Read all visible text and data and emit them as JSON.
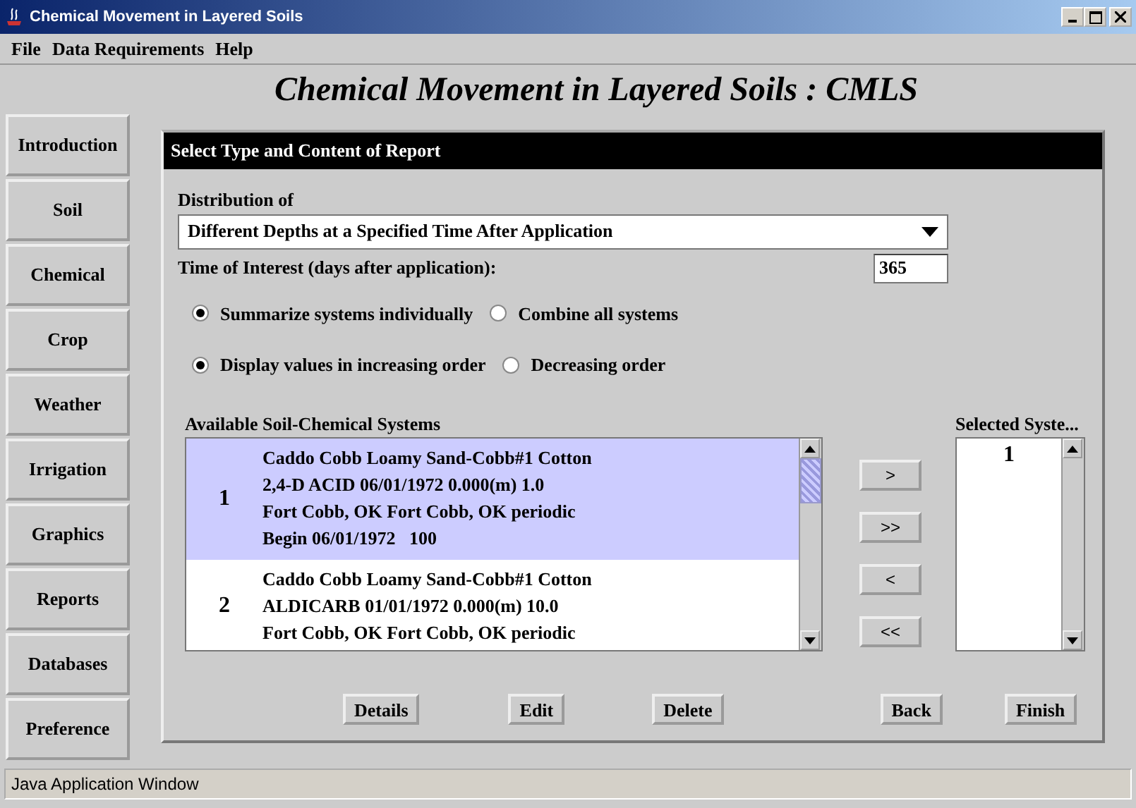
{
  "window": {
    "title": "Chemical Movement in Layered Soils"
  },
  "menu": [
    "File",
    "Data Requirements",
    "Help"
  ],
  "heading": "Chemical Movement in Layered Soils : CMLS",
  "sidebar": {
    "items": [
      "Introduction",
      "Soil",
      "Chemical",
      "Crop",
      "Weather",
      "Irrigation",
      "Graphics",
      "Reports",
      "Databases",
      "Preference"
    ]
  },
  "panel": {
    "title": "Select Type and Content of Report",
    "distribution": {
      "label": "Distribution of",
      "value": "Different Depths at a Specified Time After Application"
    },
    "time_of_interest": {
      "label": "Time of Interest (days after application):",
      "value": "365"
    },
    "radio_groups": [
      [
        {
          "label": "Summarize systems individually",
          "selected": true
        },
        {
          "label": "Combine all systems",
          "selected": false
        }
      ],
      [
        {
          "label": "Display values in increasing order",
          "selected": true
        },
        {
          "label": "Decreasing order",
          "selected": false
        }
      ]
    ],
    "available": {
      "label": "Available Soil-Chemical Systems",
      "items": [
        {
          "number": "1",
          "selected": true,
          "lines": [
            "Caddo Cobb Loamy Sand-Cobb#1 Cotton",
            "2,4-D ACID 06/01/1972 0.000(m) 1.0",
            "Fort Cobb, OK Fort Cobb, OK periodic",
            "Begin 06/01/1972   100"
          ]
        },
        {
          "number": "2",
          "selected": false,
          "lines": [
            "Caddo Cobb Loamy Sand-Cobb#1 Cotton",
            "ALDICARB 01/01/1972 0.000(m) 10.0",
            "Fort Cobb, OK Fort Cobb, OK periodic"
          ]
        }
      ]
    },
    "transfer_buttons": [
      ">",
      ">>",
      "<",
      "<<"
    ],
    "selected_systems": {
      "label": "Selected Syste...",
      "items": [
        "1"
      ]
    },
    "buttons": [
      "Details",
      "Edit",
      "Delete",
      "Back",
      "Finish"
    ]
  },
  "status_bar": "Java Application Window"
}
